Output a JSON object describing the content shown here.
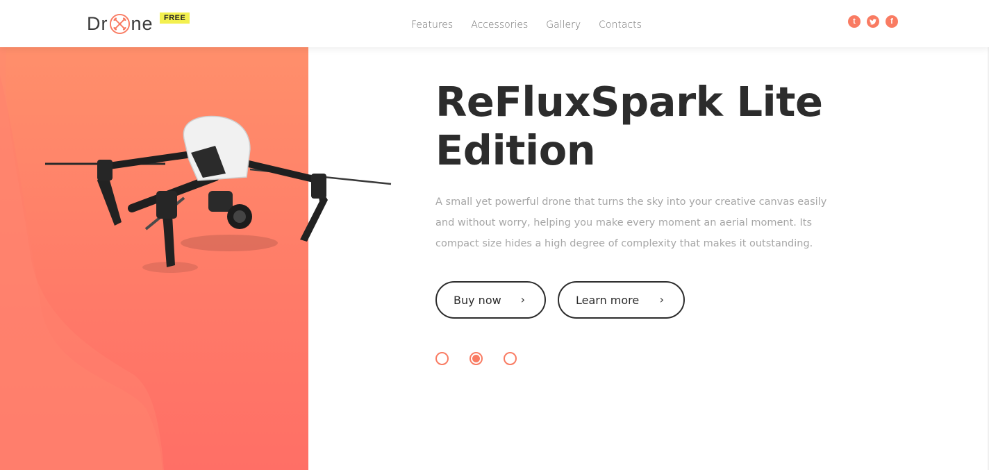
{
  "header": {
    "logo": {
      "prefix": "Dr",
      "suffix": "ne",
      "badge": "FREE"
    },
    "nav": [
      {
        "label": "Features"
      },
      {
        "label": "Accessories"
      },
      {
        "label": "Gallery"
      },
      {
        "label": "Contacts"
      }
    ],
    "social": [
      {
        "icon": "tumblr-icon",
        "glyph": "t"
      },
      {
        "icon": "twitter-icon",
        "glyph": "t"
      },
      {
        "icon": "facebook-icon",
        "glyph": "f"
      }
    ]
  },
  "hero": {
    "title": "ReFluxSpark Lite Edition",
    "description": "A small yet powerful drone that turns the sky into your creative canvas easily and without worry, helping you make every moment an aerial moment. Its compact size hides a high degree of complexity that makes it outstanding.",
    "buttons": {
      "buy": {
        "label": "Buy now",
        "icon": "chevron-right-icon",
        "glyph": "›"
      },
      "learn": {
        "label": "Learn more",
        "icon": "chevron-right-icon",
        "glyph": "›"
      }
    },
    "slider": {
      "total": 3,
      "active": 2
    }
  },
  "colors": {
    "accent": "#f97b62",
    "panel_top": "#ff8f6b",
    "panel_bottom": "#ff6f66",
    "badge": "#f3f04f",
    "text_dark": "#2c2c2c",
    "text_muted": "#a6a6a6"
  }
}
